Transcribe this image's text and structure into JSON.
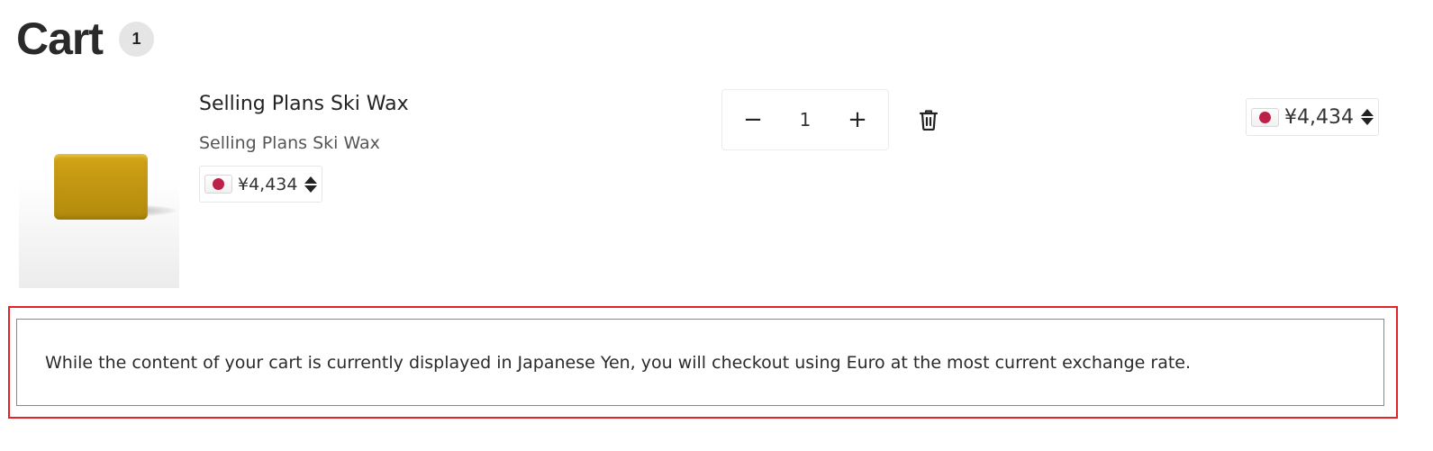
{
  "cart": {
    "title": "Cart",
    "item_count": "1"
  },
  "item": {
    "name": "Selling Plans Ski Wax",
    "variant": "Selling Plans Ski Wax",
    "unit_price": "¥4,434",
    "line_total": "¥4,434",
    "currency_flag": "japan-flag-icon",
    "quantity": "1",
    "decrease_label": "−",
    "increase_label": "+",
    "remove_icon": "trash-icon"
  },
  "notice": {
    "text": "While the content of your cart is currently displayed in Japanese Yen, you will checkout using Euro at the most current exchange rate."
  },
  "colors": {
    "flag_red": "#bc1f47",
    "highlight_border": "#e0242a",
    "badge_bg": "#e5e5e5"
  }
}
